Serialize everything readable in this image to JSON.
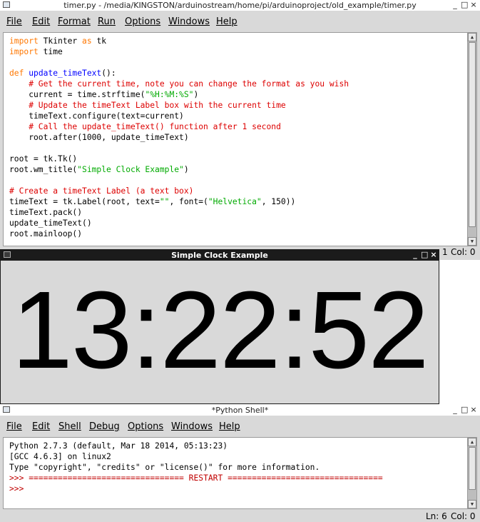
{
  "editor_window": {
    "title": "timer.py - /media/KINGSTON/arduinostream/home/pi/arduinoproject/old_example/timer.py",
    "menu": [
      "File",
      "Edit",
      "Format",
      "Run",
      "Options",
      "Windows",
      "Help"
    ],
    "code": [
      {
        "parts": [
          {
            "t": "import",
            "c": "kw"
          },
          {
            "t": " Tkinter ",
            "c": ""
          },
          {
            "t": "as",
            "c": "kw"
          },
          {
            "t": " tk",
            "c": ""
          }
        ]
      },
      {
        "parts": [
          {
            "t": "import",
            "c": "kw"
          },
          {
            "t": " time",
            "c": ""
          }
        ]
      },
      {
        "parts": []
      },
      {
        "parts": [
          {
            "t": "def",
            "c": "kw"
          },
          {
            "t": " ",
            "c": ""
          },
          {
            "t": "update_timeText",
            "c": "def"
          },
          {
            "t": "():",
            "c": ""
          }
        ]
      },
      {
        "parts": [
          {
            "t": "    # Get the current time, note you can change the format as you wish",
            "c": "cmt"
          }
        ]
      },
      {
        "parts": [
          {
            "t": "    current = time.strftime(",
            "c": ""
          },
          {
            "t": "\"%H:%M:%S\"",
            "c": "str"
          },
          {
            "t": ")",
            "c": ""
          }
        ]
      },
      {
        "parts": [
          {
            "t": "    # Update the timeText Label box with the current time",
            "c": "cmt"
          }
        ]
      },
      {
        "parts": [
          {
            "t": "    timeText.configure(text=current)",
            "c": ""
          }
        ]
      },
      {
        "parts": [
          {
            "t": "    # Call the update_timeText() function after 1 second",
            "c": "cmt"
          }
        ]
      },
      {
        "parts": [
          {
            "t": "    root.after(1000, update_timeText)",
            "c": ""
          }
        ]
      },
      {
        "parts": []
      },
      {
        "parts": [
          {
            "t": "root = tk.Tk()",
            "c": ""
          }
        ]
      },
      {
        "parts": [
          {
            "t": "root.wm_title(",
            "c": ""
          },
          {
            "t": "\"Simple Clock Example\"",
            "c": "str"
          },
          {
            "t": ")",
            "c": ""
          }
        ]
      },
      {
        "parts": []
      },
      {
        "parts": [
          {
            "t": "# Create a timeText Label (a text box)",
            "c": "cmt"
          }
        ]
      },
      {
        "parts": [
          {
            "t": "timeText = tk.Label(root, text=",
            "c": ""
          },
          {
            "t": "\"\"",
            "c": "str"
          },
          {
            "t": ", font=(",
            "c": ""
          },
          {
            "t": "\"Helvetica\"",
            "c": "str"
          },
          {
            "t": ", 150))",
            "c": ""
          }
        ]
      },
      {
        "parts": [
          {
            "t": "timeText.pack()",
            "c": ""
          }
        ]
      },
      {
        "parts": [
          {
            "t": "update_timeText()",
            "c": ""
          }
        ]
      },
      {
        "parts": [
          {
            "t": "root.mainloop()",
            "c": ""
          }
        ]
      }
    ],
    "status": {
      "ln": "1",
      "col": "Col: 0"
    }
  },
  "clock_window": {
    "title": "Simple Clock Example",
    "time": "13:22:52"
  },
  "shell_window": {
    "title": "*Python Shell*",
    "menu": [
      "File",
      "Edit",
      "Shell",
      "Debug",
      "Options",
      "Windows",
      "Help"
    ],
    "lines": [
      {
        "parts": [
          {
            "t": "Python 2.7.3 (default, Mar 18 2014, 05:13:23)",
            "c": ""
          }
        ]
      },
      {
        "parts": [
          {
            "t": "[GCC 4.6.3] on linux2",
            "c": ""
          }
        ]
      },
      {
        "parts": [
          {
            "t": "Type \"copyright\", \"credits\" or \"license()\" for more information.",
            "c": ""
          }
        ]
      },
      {
        "parts": [
          {
            "t": ">>> ",
            "c": "prm"
          },
          {
            "t": "================================ RESTART ================================",
            "c": "prm"
          }
        ]
      },
      {
        "parts": [
          {
            "t": ">>> ",
            "c": "prm"
          }
        ]
      }
    ],
    "status": {
      "ln": "Ln: 6",
      "col": "Col: 0"
    }
  },
  "icons": {
    "minimize": "_",
    "maximize": "□",
    "close": "×",
    "scroll_up": "▲",
    "scroll_down": "▼"
  }
}
